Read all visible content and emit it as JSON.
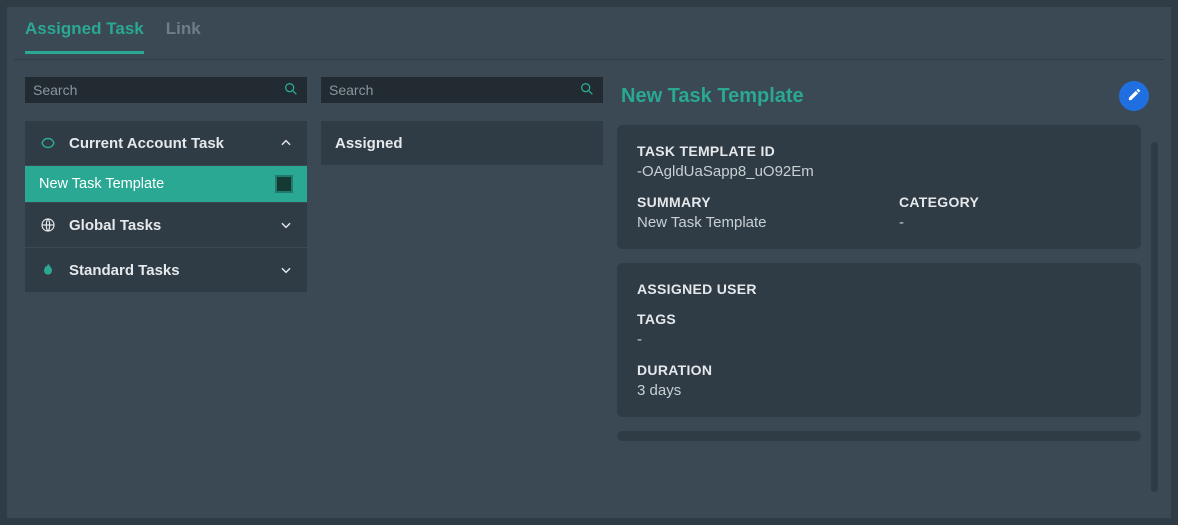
{
  "tabs": {
    "assigned_task": "Assigned Task",
    "link": "Link"
  },
  "left": {
    "search_placeholder": "Search",
    "sections": {
      "current": "Current Account Task",
      "global": "Global Tasks",
      "standard": "Standard Tasks"
    },
    "items": {
      "new_task_template": "New Task Template"
    }
  },
  "mid": {
    "search_placeholder": "Search",
    "assigned": "Assigned"
  },
  "detail": {
    "title": "New Task Template",
    "fields": {
      "task_template_id_label": "TASK TEMPLATE ID",
      "task_template_id_value": "-OAgldUaSapp8_uO92Em",
      "summary_label": "SUMMARY",
      "summary_value": "New Task Template",
      "category_label": "CATEGORY",
      "category_value": "-",
      "assigned_user_label": "ASSIGNED USER",
      "tags_label": "TAGS",
      "tags_value": "-",
      "duration_label": "DURATION",
      "duration_value": "3 days"
    }
  }
}
